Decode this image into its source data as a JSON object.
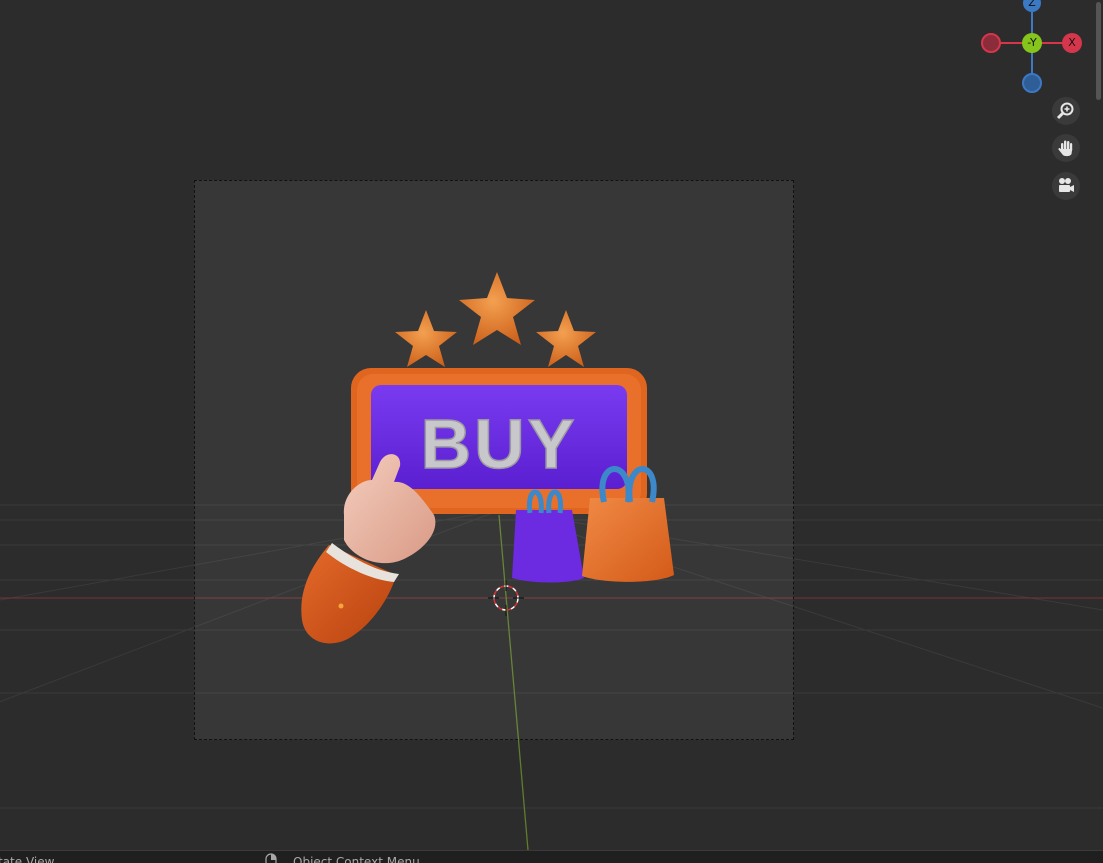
{
  "viewport": {
    "gizmo": {
      "z": "Z",
      "y": "-Y",
      "x": "X"
    },
    "scene_label": "BUY",
    "icons": [
      "zoom-icon",
      "hand-pan-icon",
      "camera-icon"
    ]
  },
  "status_bar": {
    "left_label": "tate View",
    "context_label": "Object Context Menu"
  },
  "colors": {
    "accent_orange": "#e0651f",
    "button_purple": "#6c2be0",
    "gizmo_x": "#d6364b",
    "gizmo_y": "#86c51b",
    "gizmo_z": "#3b79c5"
  }
}
